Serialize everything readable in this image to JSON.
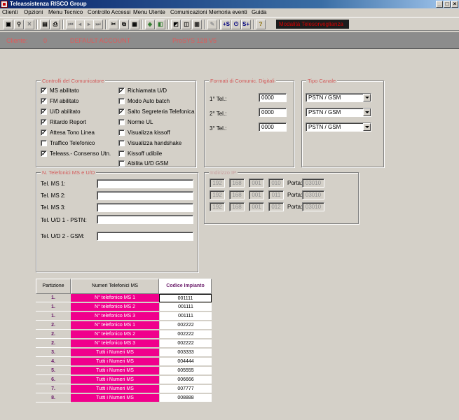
{
  "window": {
    "title": "Teleassistenza RISCO Group",
    "min": "_",
    "max": "□",
    "close": "×"
  },
  "menu": [
    "Clienti",
    "Opzioni",
    "Menu Tecnico",
    "Controllo Accessi",
    "Menu Utente",
    "Comunicazioni",
    "Memoria eventi",
    "Guida"
  ],
  "toolbar": {
    "btn_plus_s": "+S",
    "btn_s_plus": "S+",
    "btn_help": "?",
    "status_text": "Modalità Telesorveglianza"
  },
  "client": {
    "label": "Cliente:",
    "id": "0",
    "name": "DEFAULT ACCOUNT",
    "panel": "ProSYS 128 V5"
  },
  "controls": {
    "title": "Controlli del Comunicatore",
    "left": [
      {
        "label": "MS abilitato",
        "checked": true
      },
      {
        "label": "FM abilitato",
        "checked": true
      },
      {
        "label": "U/D abilitato",
        "checked": true
      },
      {
        "label": "Ritardo Report",
        "checked": true
      },
      {
        "label": "Attesa Tono Linea",
        "checked": true
      },
      {
        "label": "Traffico Telefonico",
        "checked": false
      },
      {
        "label": "Teleass.- Consenso Utn.",
        "checked": true
      }
    ],
    "right": [
      {
        "label": "Richiamata U/D",
        "checked": true
      },
      {
        "label": "Modo Auto batch",
        "checked": false
      },
      {
        "label": "Salto Segreteria Telefonica",
        "checked": true
      },
      {
        "label": "Norme UL",
        "checked": false
      },
      {
        "label": "Visualizza kissoff",
        "checked": false
      },
      {
        "label": "Visualizza handshake",
        "checked": false
      },
      {
        "label": "Kissoff udibile",
        "checked": false
      },
      {
        "label": "Abilita U/D GSM",
        "checked": false
      }
    ]
  },
  "formats": {
    "title": "Formati di Comunic. Digitali",
    "rows": [
      {
        "label": "1° Tel.:",
        "value": "0000"
      },
      {
        "label": "2° Tel.:",
        "value": "0000"
      },
      {
        "label": "3° Tel.:",
        "value": "0000"
      }
    ]
  },
  "channel": {
    "title": "Tipo Canale",
    "options": [
      "PSTN / GSM",
      "PSTN / GSM",
      "PSTN / GSM"
    ]
  },
  "phones": {
    "title": "N. Telefonici MS e U/D",
    "rows": [
      {
        "label": "Tel. MS 1:",
        "value": ""
      },
      {
        "label": "Tel. MS 2:",
        "value": ""
      },
      {
        "label": "Tel. MS 3:",
        "value": ""
      },
      {
        "label": "Tel. U/D 1 - PSTN:",
        "value": ""
      },
      {
        "label": "Tel. U/D 2 - GSM:",
        "value": ""
      }
    ]
  },
  "ip": {
    "title": "Indirizzo IP",
    "port_label": "Porta:",
    "rows": [
      {
        "octets": [
          "192",
          "168",
          "001",
          "010"
        ],
        "port": "03010"
      },
      {
        "octets": [
          "192",
          "168",
          "001",
          "011"
        ],
        "port": "03010"
      },
      {
        "octets": [
          "192",
          "168",
          "001",
          "012"
        ],
        "port": "03010"
      }
    ]
  },
  "table": {
    "headers": {
      "partition": "Partizione",
      "numbers": "Numeri Telefonici MS",
      "code": "Codice Impianto"
    },
    "rows": [
      {
        "partition": "1.",
        "number": "N° telefonico MS 1",
        "code": "001111"
      },
      {
        "partition": "1.",
        "number": "N° telefonico MS 2",
        "code": "001111"
      },
      {
        "partition": "1.",
        "number": "N° telefonico MS 3",
        "code": "001111"
      },
      {
        "partition": "2.",
        "number": "N° telefonico MS 1",
        "code": "002222"
      },
      {
        "partition": "2.",
        "number": "N° telefonico MS 2",
        "code": "002222"
      },
      {
        "partition": "2.",
        "number": "N° telefonico MS 3",
        "code": "002222"
      },
      {
        "partition": "3.",
        "number": "Tutti i Numeri MS",
        "code": "003333"
      },
      {
        "partition": "4.",
        "number": "Tutti i Numeri MS",
        "code": "004444"
      },
      {
        "partition": "5.",
        "number": "Tutti i Numeri MS",
        "code": "005555"
      },
      {
        "partition": "6.",
        "number": "Tutti i Numeri MS",
        "code": "006666"
      },
      {
        "partition": "7.",
        "number": "Tutti i Numeri MS",
        "code": "007777"
      },
      {
        "partition": "8.",
        "number": "Tutti i Numeri MS",
        "code": "008888"
      }
    ]
  },
  "colors": {
    "accent_red": "#d35a5a",
    "partition_magenta": "#f0008c",
    "header_purple": "#6a1b6a"
  }
}
